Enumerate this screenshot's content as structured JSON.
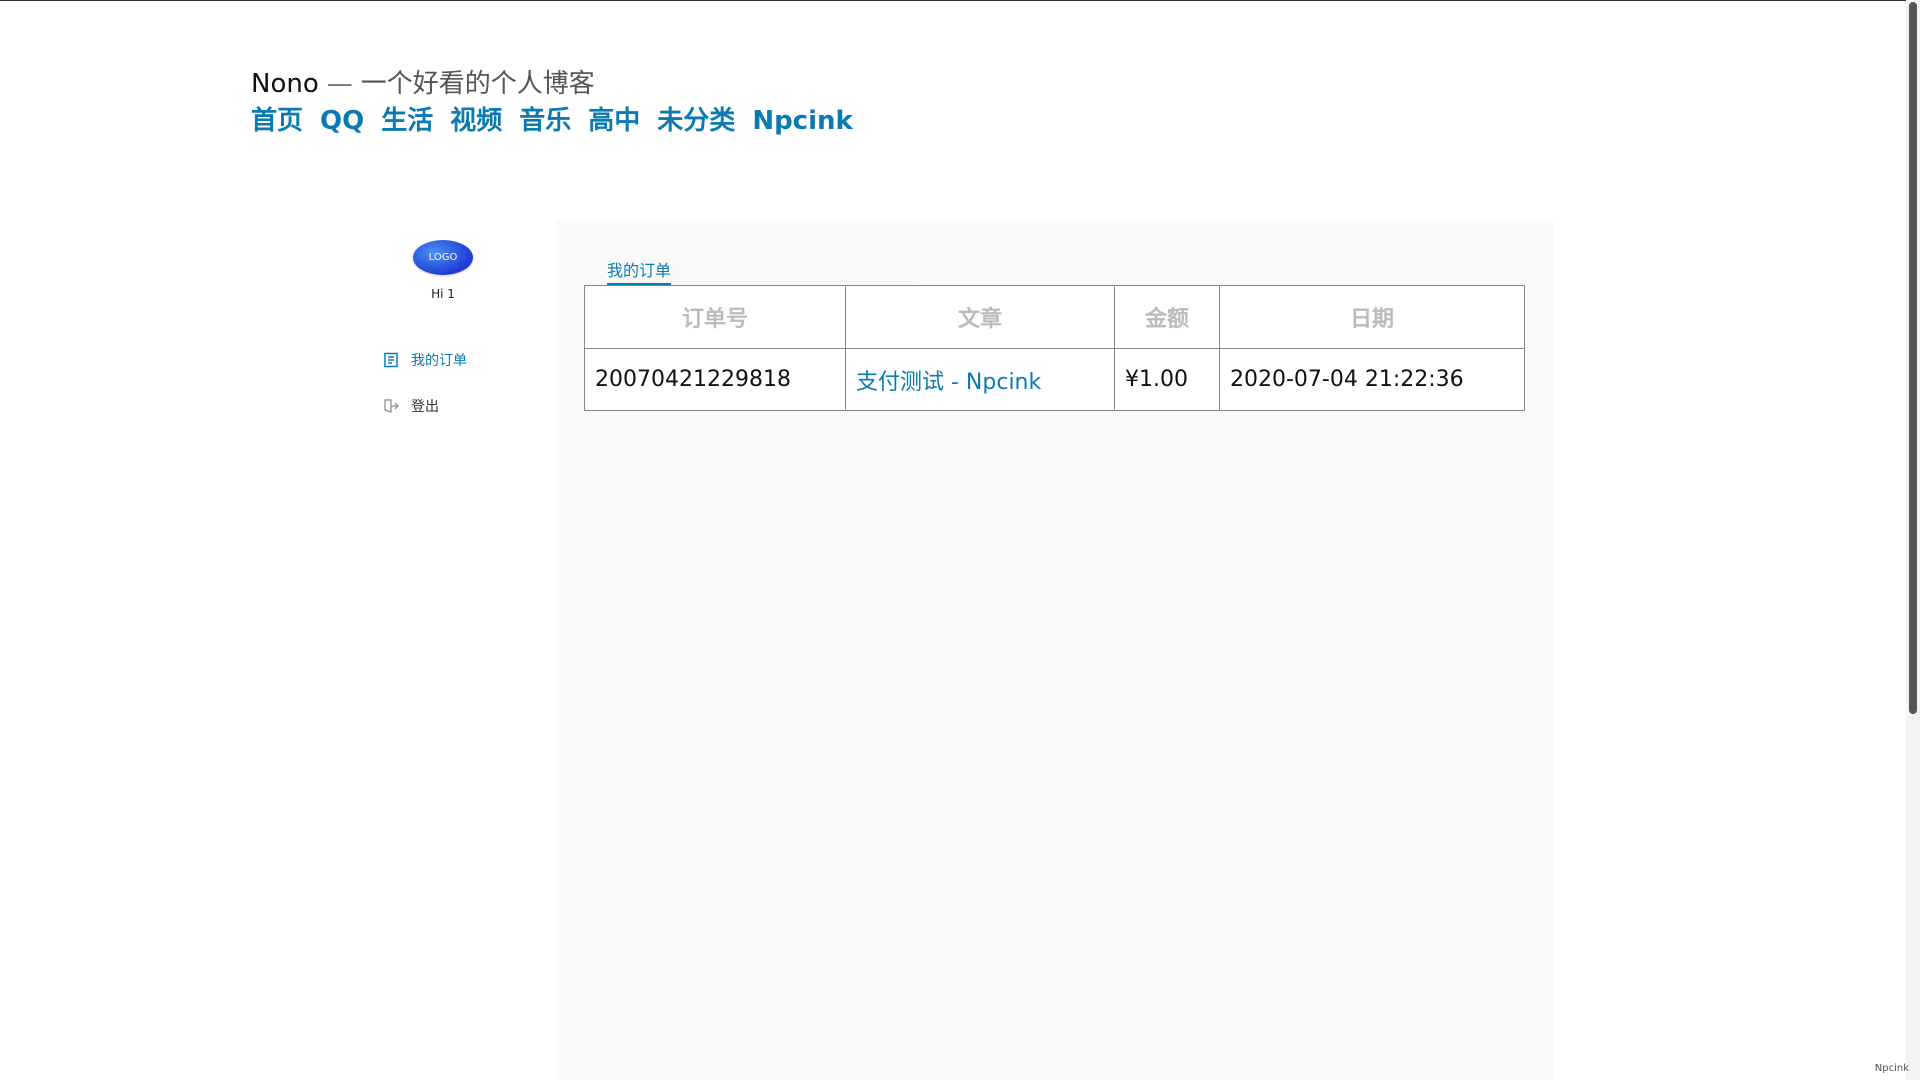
{
  "site": {
    "name": "Nono",
    "separator": "—",
    "tagline": "一个好看的个人博客"
  },
  "nav": {
    "items": [
      "首页",
      "QQ",
      "生活",
      "视频",
      "音乐",
      "高中",
      "未分类",
      "Npcink"
    ]
  },
  "sidebar": {
    "avatar_text": "LOGO",
    "greeting": "Hi 1",
    "my_orders": "我的订单",
    "logout": "登出"
  },
  "tabs": {
    "active": "我的订单"
  },
  "orders_table": {
    "headers": [
      "订单号",
      "文章",
      "金额",
      "日期"
    ],
    "rows": [
      {
        "order_id": "20070421229818",
        "article": "支付测试 - Npcink",
        "amount": "¥1.00",
        "date": "2020-07-04 21:22:36"
      }
    ]
  },
  "footer": {
    "mark": "Npcink"
  },
  "colors": {
    "link": "#0a7ab2",
    "avatar": "#1f3bd6",
    "content_bg": "#fafafa"
  }
}
